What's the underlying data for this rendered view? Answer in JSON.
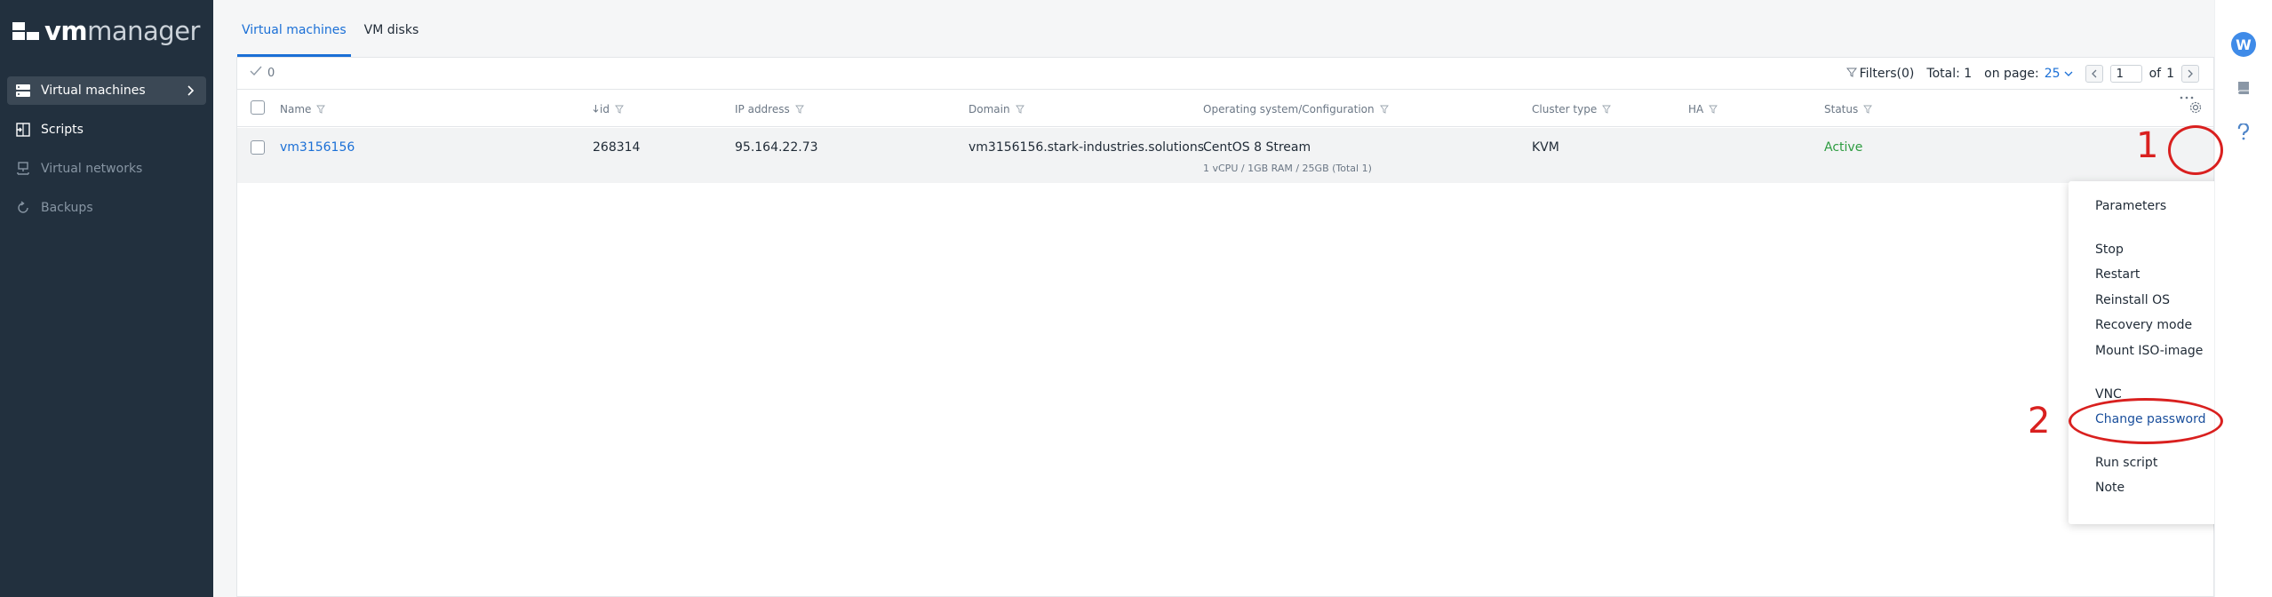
{
  "app": {
    "brand_strong": "vm",
    "brand_light": "manager"
  },
  "sidebar": {
    "items": [
      {
        "label": "Virtual machines",
        "icon": "server-icon",
        "active": true
      },
      {
        "label": "Scripts",
        "icon": "scripts-icon",
        "active": false
      },
      {
        "label": "Virtual networks",
        "icon": "network-icon",
        "active": false
      },
      {
        "label": "Backups",
        "icon": "backup-icon",
        "active": false
      }
    ]
  },
  "rail": {
    "avatar_letter": "W",
    "icons": [
      "book-icon",
      "help-icon"
    ]
  },
  "tabs": [
    {
      "label": "Virtual machines",
      "active": true
    },
    {
      "label": "VM disks",
      "active": false
    }
  ],
  "toolbar": {
    "selected_count": "0",
    "filters_label": "Filters(0)",
    "total_label": "Total: 1",
    "on_page_label": "on page:",
    "on_page_value": "25",
    "page_value": "1",
    "of_label": "of",
    "total_pages": "1"
  },
  "table": {
    "columns": [
      "Name",
      "id",
      "IP address",
      "Domain",
      "Operating system/Configuration",
      "Cluster type",
      "HA",
      "Status"
    ],
    "rows": [
      {
        "name": "vm3156156",
        "id": "268314",
        "ip": "95.164.22.73",
        "domain": "vm3156156.stark-industries.solutions",
        "os": "CentOS 8 Stream",
        "config": "1 vCPU / 1GB RAM / 25GB (Total 1)",
        "cluster_type": "KVM",
        "ha": "",
        "status": "Active"
      }
    ]
  },
  "menu": {
    "title": "Parameters",
    "items": [
      "Stop",
      "Restart",
      "Reinstall OS",
      "Recovery mode",
      "Mount ISO-image",
      "VNC",
      "Change password",
      "Run script",
      "Note"
    ]
  },
  "annotations": {
    "step1": "1",
    "step2": "2",
    "color": "#d9201f"
  },
  "colors": {
    "sidebar_bg": "#22303e",
    "accent": "#1a6fd6",
    "status_active": "#2e9c41"
  }
}
